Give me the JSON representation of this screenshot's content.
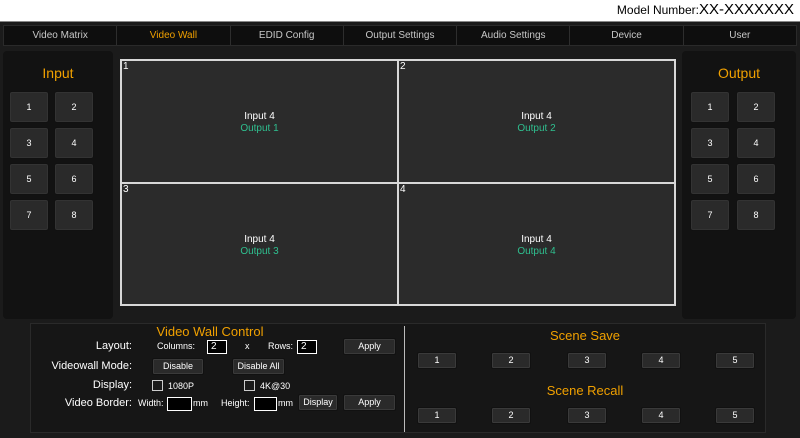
{
  "header": {
    "model_label": "Model Number:",
    "model_value": "XX-XXXXXXX"
  },
  "nav": {
    "tabs": [
      "Video Matrix",
      "Video Wall",
      "EDID Config",
      "Output Settings",
      "Audio Settings",
      "Device",
      "User"
    ],
    "active_tab": "Video Wall"
  },
  "input_panel": {
    "title": "Input",
    "buttons": [
      "1",
      "2",
      "3",
      "4",
      "5",
      "6",
      "7",
      "8"
    ]
  },
  "output_panel": {
    "title": "Output",
    "buttons": [
      "1",
      "2",
      "3",
      "4",
      "5",
      "6",
      "7",
      "8"
    ]
  },
  "wall": {
    "cells": [
      {
        "num": "1",
        "input": "Input 4",
        "output": "Output 1"
      },
      {
        "num": "2",
        "input": "Input 4",
        "output": "Output 2"
      },
      {
        "num": "3",
        "input": "Input 4",
        "output": "Output 3"
      },
      {
        "num": "4",
        "input": "Input 4",
        "output": "Output 4"
      }
    ]
  },
  "control": {
    "title": "Video Wall Control",
    "layout_label": "Layout:",
    "columns_label": "Columns:",
    "columns_value": "2",
    "x_label": "x",
    "rows_label": "Rows:",
    "rows_value": "2",
    "apply_label": "Apply",
    "mode_label": "Videowall Mode:",
    "disable_label": "Disable",
    "disable_all_label": "Disable All",
    "display_label": "Display:",
    "opt_1080p": "1080P",
    "opt_4k": "4K@30",
    "border_label": "Video Border:",
    "width_label": "Width:",
    "width_value": "",
    "mm_label": "mm",
    "height_label": "Height:",
    "height_value": "",
    "display_btn_label": "Display",
    "apply2_label": "Apply"
  },
  "scene_save": {
    "title": "Scene Save",
    "buttons": [
      "1",
      "2",
      "3",
      "4",
      "5"
    ]
  },
  "scene_recall": {
    "title": "Scene Recall",
    "buttons": [
      "1",
      "2",
      "3",
      "4",
      "5"
    ]
  },
  "colors": {
    "accent": "#f0a000",
    "output_text": "#2fbf8f",
    "background": "#1b1b1b"
  }
}
